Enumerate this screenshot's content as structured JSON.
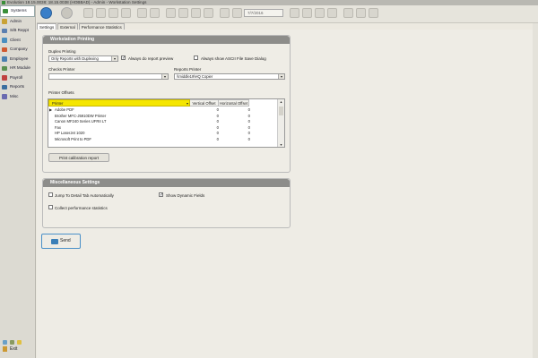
{
  "window": {
    "title": "Evolution 18.15.0038: 18.15.0038 (HOBBAD) - Admin - Workstation Settings"
  },
  "sidebar": {
    "items": [
      {
        "label": "Systems",
        "color": "#3a8f3a",
        "active": true
      },
      {
        "label": "Admin",
        "color": "#c9a234"
      },
      {
        "label": "S/B Reppt",
        "color": "#5a7fb0"
      },
      {
        "label": "Client",
        "color": "#4a8fc0"
      },
      {
        "label": "Company",
        "color": "#d05a30"
      },
      {
        "label": "Employee",
        "color": "#4a7fb0"
      },
      {
        "label": "HR Module",
        "color": "#5a9050"
      },
      {
        "label": "Payroll",
        "color": "#c04040"
      },
      {
        "label": "Reports",
        "color": "#3a6fa0"
      },
      {
        "label": "Misc",
        "color": "#6a6ab0"
      }
    ],
    "exit_label": "Exit"
  },
  "toolbar": {
    "date_value": "7/7/2016"
  },
  "tabs": [
    {
      "label": "Settings",
      "active": true
    },
    {
      "label": "External"
    },
    {
      "label": "Performance Statistics"
    }
  ],
  "workstation_printing": {
    "header": "Workstation Printing",
    "duplex_label": "Duplex Printing",
    "duplex_value": "Only Reports with Duplexing",
    "always_preview_label": "Always do report preview",
    "always_preview_checked": true,
    "ascii_dialog_label": "Always show ASCII File Save Dialog",
    "ascii_dialog_checked": false,
    "checks_printer_label": "Checks Printer",
    "checks_printer_value": "",
    "reports_printer_label": "Reports Printer",
    "reports_printer_value": "\\\\middle19\\HQ Copier",
    "printer_offsets_label": "Printer Offsets",
    "columns": {
      "printer": "Printer",
      "vertical": "Vertical Offset",
      "horizontal": "Horizontal Offset"
    },
    "rows": [
      {
        "printer": "Adobe PDF",
        "vertical": "0",
        "horizontal": "0"
      },
      {
        "printer": "Brother MFC-J5910DW Printer",
        "vertical": "0",
        "horizontal": "0"
      },
      {
        "printer": "Canon MF240 Series UFRII LT",
        "vertical": "0",
        "horizontal": "0"
      },
      {
        "printer": "Fax",
        "vertical": "0",
        "horizontal": "0"
      },
      {
        "printer": "HP LaserJet 1020",
        "vertical": "0",
        "horizontal": "0"
      },
      {
        "printer": "Microsoft Print to PDF",
        "vertical": "0",
        "horizontal": "0"
      }
    ],
    "calibration_button": "Print calibration report"
  },
  "misc_settings": {
    "header": "Miscellaneous Settings",
    "jump_label": "Jump To Detail Tab Automatically",
    "jump_checked": false,
    "dynamic_label": "Show Dynamic Fields",
    "dynamic_checked": true,
    "collect_label": "Collect performance statistics",
    "collect_checked": false
  },
  "send_button": "Send"
}
